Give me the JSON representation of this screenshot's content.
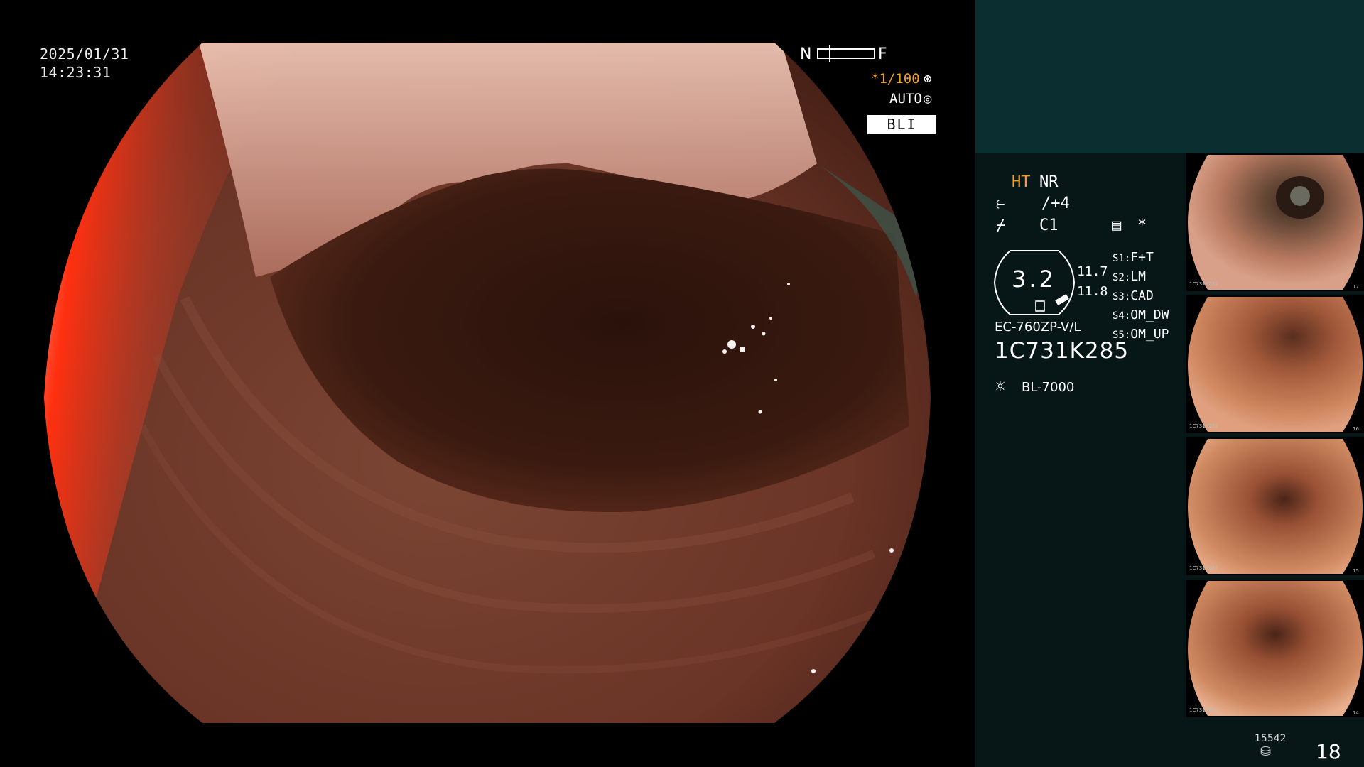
{
  "overlay": {
    "date": "2025/01/31",
    "time": "14:23:31",
    "focus_near": "N",
    "focus_far": "F",
    "shutter": "*1/100",
    "shutter_icon": "⊛",
    "iris": "AUTO",
    "iris_icon": "◎",
    "mode": "BLI"
  },
  "info": {
    "ht": "HT",
    "nr": "NR",
    "enhance_icon": "⥼",
    "enhance_value": "/+4",
    "color_icon": "⌿",
    "color_value": "C1",
    "settings_icon": "▤",
    "asterisk": "*",
    "zoom": "3.2",
    "reading_1": "11.7",
    "reading_2": "11.8",
    "switches": [
      {
        "key": "S1",
        "value": "F+T"
      },
      {
        "key": "S2",
        "value": "LM"
      },
      {
        "key": "S3",
        "value": "CAD"
      },
      {
        "key": "S4",
        "value": "OM_DW"
      },
      {
        "key": "S5",
        "value": "OM_UP"
      }
    ],
    "scope_model": "EC-760ZP-V/L",
    "serial": "1C731K285",
    "light_icon": "☼",
    "light_source": "BL-7000",
    "image_count": "15542",
    "image_icon": "⛁",
    "page_number": "18"
  },
  "thumbnails": [
    {
      "serial": "1C731K285",
      "index": "17"
    },
    {
      "serial": "1C731K285",
      "index": "16"
    },
    {
      "serial": "1C731K285",
      "index": "15"
    },
    {
      "serial": "1C731K285",
      "index": "14"
    }
  ],
  "colors": {
    "accent_orange": "#f0a020",
    "panel_bg": "#071718",
    "panel_top_bg": "#0b2f30"
  }
}
